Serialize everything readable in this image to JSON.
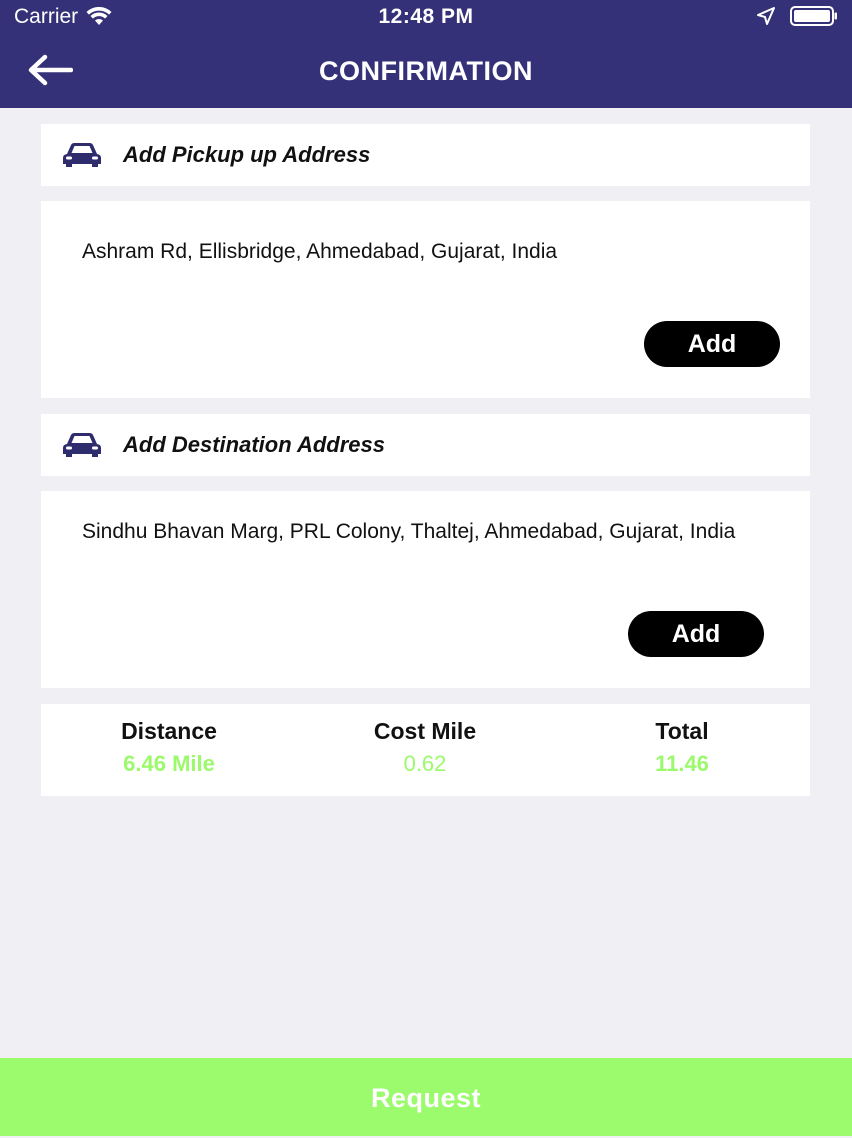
{
  "status_bar": {
    "carrier": "Carrier",
    "time": "12:48 PM"
  },
  "header": {
    "title": "CONFIRMATION"
  },
  "pickup": {
    "title": "Add Pickup up Address",
    "address": "Ashram Rd, Ellisbridge, Ahmedabad, Gujarat, India",
    "add_label": "Add"
  },
  "destination": {
    "title": "Add Destination Address",
    "address": "Sindhu Bhavan Marg, PRL Colony, Thaltej, Ahmedabad, Gujarat, India",
    "add_label": "Add"
  },
  "summary": {
    "distance_label": "Distance",
    "distance_value": "6.46 Mile",
    "cost_label": "Cost Mile",
    "cost_value": "0.62",
    "total_label": "Total",
    "total_value": "11.46"
  },
  "footer": {
    "request_label": "Request"
  },
  "colors": {
    "header_bg": "#353178",
    "accent_green": "#9bfb6d",
    "car_icon": "#2f2c6e",
    "page_bg": "#efeff4"
  },
  "icons": {
    "back": "arrow-left-icon",
    "car": "car-icon",
    "wifi": "wifi-icon",
    "location": "location-arrow-icon",
    "battery": "battery-icon"
  }
}
